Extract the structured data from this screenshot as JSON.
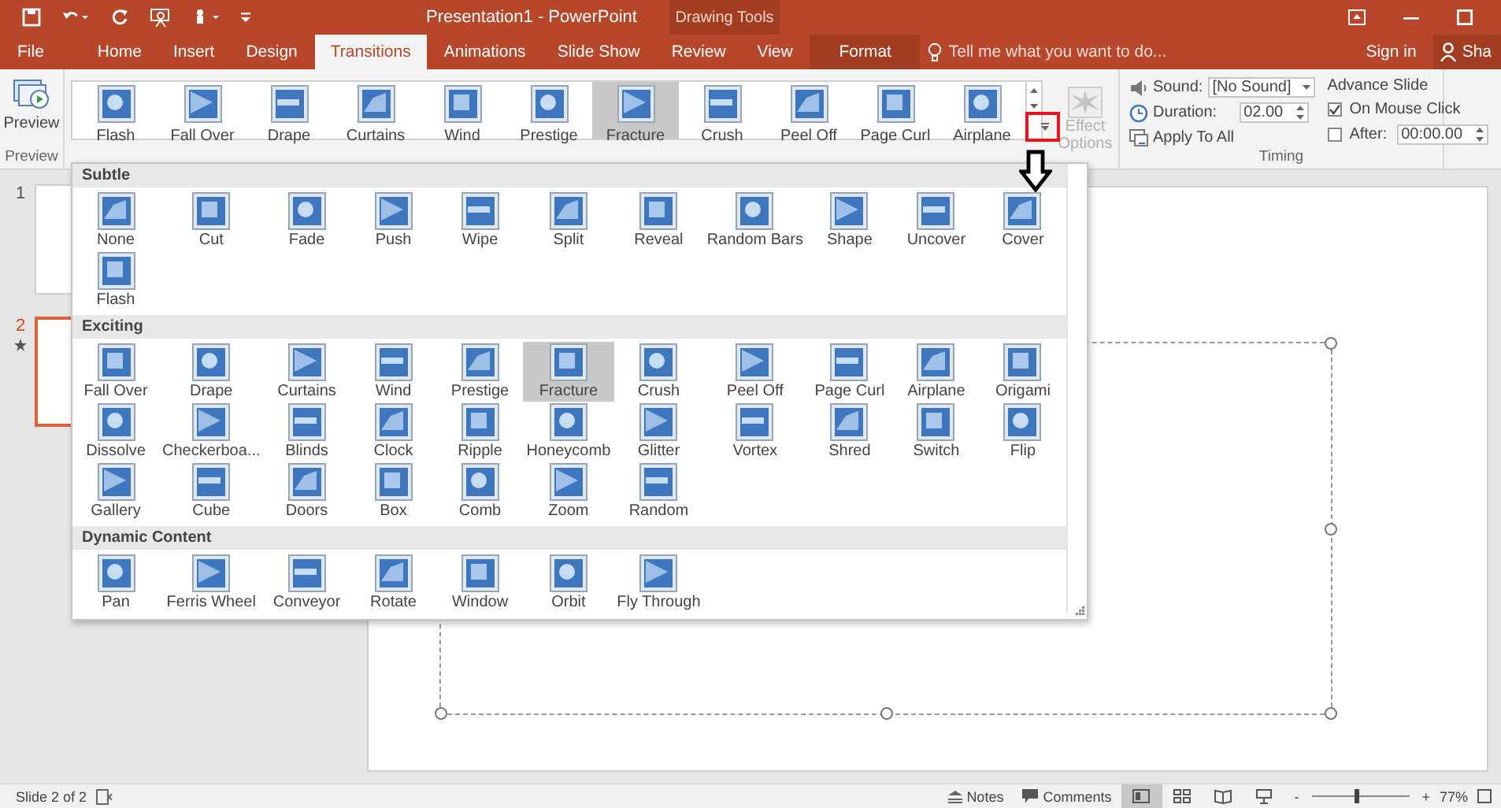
{
  "title_bar": {
    "title": "Presentation1 - PowerPoint",
    "context_label": "Drawing Tools"
  },
  "tabs": [
    {
      "label": "File",
      "kind": "file",
      "selected": false
    },
    {
      "label": "Home",
      "kind": "tab",
      "selected": false
    },
    {
      "label": "Insert",
      "kind": "tab",
      "selected": false
    },
    {
      "label": "Design",
      "kind": "tab",
      "selected": false
    },
    {
      "label": "Transitions",
      "kind": "tab",
      "selected": true
    },
    {
      "label": "Animations",
      "kind": "tab",
      "selected": false
    },
    {
      "label": "Slide Show",
      "kind": "tab",
      "selected": false
    },
    {
      "label": "Review",
      "kind": "tab",
      "selected": false
    },
    {
      "label": "View",
      "kind": "tab",
      "selected": false
    },
    {
      "label": "Format",
      "kind": "context",
      "selected": false
    }
  ],
  "tell_me": {
    "placeholder": "Tell me what you want to do..."
  },
  "sign_in": "Sign in",
  "share": "Sha",
  "ribbon": {
    "preview_button": "Preview",
    "preview_group": "Preview",
    "gallery": [
      {
        "label": "Flash",
        "selected": false
      },
      {
        "label": "Fall Over",
        "selected": false
      },
      {
        "label": "Drape",
        "selected": false
      },
      {
        "label": "Curtains",
        "selected": false
      },
      {
        "label": "Wind",
        "selected": false
      },
      {
        "label": "Prestige",
        "selected": false
      },
      {
        "label": "Fracture",
        "selected": true
      },
      {
        "label": "Crush",
        "selected": false
      },
      {
        "label": "Peel Off",
        "selected": false
      },
      {
        "label": "Page Curl",
        "selected": false
      },
      {
        "label": "Airplane",
        "selected": false
      }
    ],
    "effect_options": {
      "label": "Effect Options",
      "disabled": true
    },
    "timing": {
      "sound": {
        "label": "Sound:",
        "value": "[No Sound]"
      },
      "duration": {
        "label": "Duration:",
        "value": "02.00"
      },
      "apply_all": "Apply To All",
      "advance_title": "Advance Slide",
      "on_mouse_click": {
        "label": "On Mouse Click",
        "checked": true
      },
      "after": {
        "label": "After:",
        "checked": false,
        "value": "00:00.00"
      },
      "group_label": "Timing"
    }
  },
  "slides": [
    {
      "number": "1",
      "selected": false,
      "has_transition": false
    },
    {
      "number": "2",
      "selected": true,
      "has_transition": true
    }
  ],
  "transition_gallery": {
    "sections": [
      {
        "title": "Subtle",
        "items": [
          {
            "label": "None",
            "selected": false
          },
          {
            "label": "Cut",
            "selected": false
          },
          {
            "label": "Fade",
            "selected": false
          },
          {
            "label": "Push",
            "selected": false
          },
          {
            "label": "Wipe",
            "selected": false
          },
          {
            "label": "Split",
            "selected": false
          },
          {
            "label": "Reveal",
            "selected": false
          },
          {
            "label": "Random Bars",
            "selected": false
          },
          {
            "label": "Shape",
            "selected": false
          },
          {
            "label": "Uncover",
            "selected": false
          },
          {
            "label": "Cover",
            "selected": false
          },
          {
            "label": "Flash",
            "selected": false
          }
        ]
      },
      {
        "title": "Exciting",
        "items": [
          {
            "label": "Fall Over",
            "selected": false
          },
          {
            "label": "Drape",
            "selected": false
          },
          {
            "label": "Curtains",
            "selected": false
          },
          {
            "label": "Wind",
            "selected": false
          },
          {
            "label": "Prestige",
            "selected": false
          },
          {
            "label": "Fracture",
            "selected": true
          },
          {
            "label": "Crush",
            "selected": false
          },
          {
            "label": "Peel Off",
            "selected": false
          },
          {
            "label": "Page Curl",
            "selected": false
          },
          {
            "label": "Airplane",
            "selected": false
          },
          {
            "label": "Origami",
            "selected": false
          },
          {
            "label": "Dissolve",
            "selected": false
          },
          {
            "label": "Checkerboa...",
            "selected": false
          },
          {
            "label": "Blinds",
            "selected": false
          },
          {
            "label": "Clock",
            "selected": false
          },
          {
            "label": "Ripple",
            "selected": false
          },
          {
            "label": "Honeycomb",
            "selected": false
          },
          {
            "label": "Glitter",
            "selected": false
          },
          {
            "label": "Vortex",
            "selected": false
          },
          {
            "label": "Shred",
            "selected": false
          },
          {
            "label": "Switch",
            "selected": false
          },
          {
            "label": "Flip",
            "selected": false
          },
          {
            "label": "Gallery",
            "selected": false
          },
          {
            "label": "Cube",
            "selected": false
          },
          {
            "label": "Doors",
            "selected": false
          },
          {
            "label": "Box",
            "selected": false
          },
          {
            "label": "Comb",
            "selected": false
          },
          {
            "label": "Zoom",
            "selected": false
          },
          {
            "label": "Random",
            "selected": false
          }
        ]
      },
      {
        "title": "Dynamic Content",
        "items": [
          {
            "label": "Pan",
            "selected": false
          },
          {
            "label": "Ferris Wheel",
            "selected": false
          },
          {
            "label": "Conveyor",
            "selected": false
          },
          {
            "label": "Rotate",
            "selected": false
          },
          {
            "label": "Window",
            "selected": false
          },
          {
            "label": "Orbit",
            "selected": false
          },
          {
            "label": "Fly Through",
            "selected": false
          }
        ]
      }
    ]
  },
  "status_bar": {
    "slide_info": "Slide 2 of 2",
    "notes": "Notes",
    "comments": "Comments",
    "views": [
      {
        "kind": "normal",
        "selected": true
      },
      {
        "kind": "sorter",
        "selected": false
      },
      {
        "kind": "reading",
        "selected": false
      },
      {
        "kind": "slideshow",
        "selected": false
      }
    ],
    "zoom_out": "-",
    "zoom": {
      "level": 0.45
    },
    "zoom_in": "+",
    "zoom_percent": "77%"
  }
}
